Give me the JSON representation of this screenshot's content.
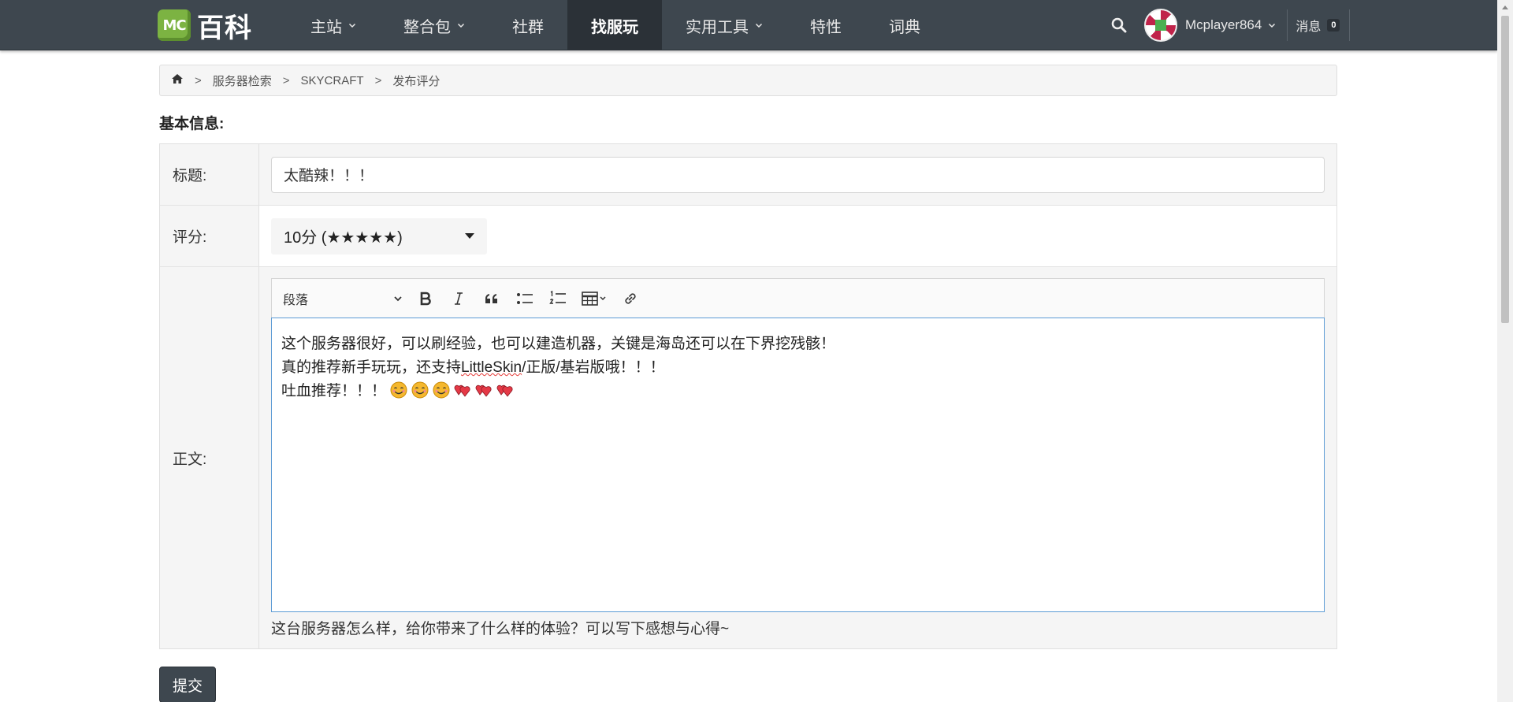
{
  "brand": {
    "badge": "MC",
    "name": "百科",
    "badge_color": "#7cb342"
  },
  "nav": {
    "items": [
      {
        "label": "主站",
        "dropdown": true
      },
      {
        "label": "整合包",
        "dropdown": true
      },
      {
        "label": "社群",
        "dropdown": false
      },
      {
        "label": "找服玩",
        "dropdown": false,
        "active": true
      },
      {
        "label": "实用工具",
        "dropdown": true
      },
      {
        "label": "特性",
        "dropdown": false
      },
      {
        "label": "词典",
        "dropdown": false
      }
    ],
    "bar_color": "#3e474f"
  },
  "user": {
    "name": "Mcplayer864",
    "messages_label": "消息",
    "messages_count": "0"
  },
  "breadcrumb": {
    "items": [
      "服务器检索",
      "SKYCRAFT",
      "发布评分"
    ],
    "separator": ">"
  },
  "section_title": "基本信息:",
  "form": {
    "title_label": "标题:",
    "title_value": "太酷辣！！！",
    "rating_label": "评分:",
    "rating_value": "10分 (★★★★★)",
    "body_label": "正文:",
    "toolbar": {
      "paragraph_label": "段落"
    },
    "body_lines": [
      "这个服务器很好，可以刷经验，也可以建造机器，关键是海岛还可以在下界挖残骸！",
      "真的推荐新手玩玩，还支持",
      "LittleSkin",
      "/正版/基岩版哦！！！",
      "吐血推荐！！！"
    ],
    "helper_text": "这台服务器怎么样，给你带来了什么样的体验？可以写下感想与心得~"
  },
  "submit_label": "提交",
  "colors": {
    "editor_focus": "#5b9bd5",
    "heart": "#e53946",
    "smile": "#f5b82e"
  }
}
